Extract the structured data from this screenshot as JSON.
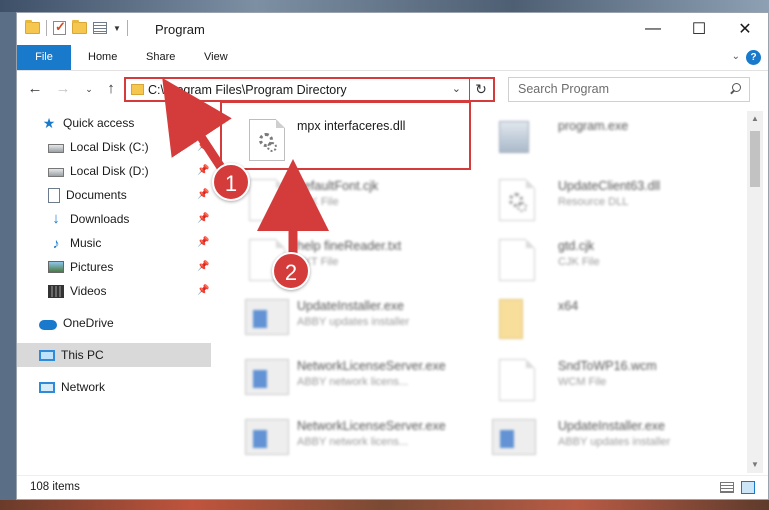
{
  "window": {
    "title": "Program",
    "controls": {
      "minimize": "—",
      "maximize": "☐",
      "close": "✕"
    }
  },
  "ribbon": {
    "tabs": [
      "File",
      "Home",
      "Share",
      "View"
    ],
    "help": "?"
  },
  "navigation": {
    "back": "←",
    "forward": "→",
    "recent": "⌄",
    "up": "↑",
    "address_path": "C:\\Program Files\\Program Directory",
    "refresh": "↻",
    "search_placeholder": "Search Program"
  },
  "sidebar": {
    "items": [
      {
        "label": "Quick access",
        "icon": "star-icon",
        "pinned": false
      },
      {
        "label": "Local Disk (C:)",
        "icon": "drive-icon",
        "pinned": true
      },
      {
        "label": "Local Disk (D:)",
        "icon": "drive-icon",
        "pinned": true
      },
      {
        "label": "Documents",
        "icon": "documents-icon",
        "pinned": true
      },
      {
        "label": "Downloads",
        "icon": "download-icon",
        "pinned": true
      },
      {
        "label": "Music",
        "icon": "music-icon",
        "pinned": true
      },
      {
        "label": "Pictures",
        "icon": "pictures-icon",
        "pinned": true
      },
      {
        "label": "Videos",
        "icon": "videos-icon",
        "pinned": true
      },
      {
        "label": "OneDrive",
        "icon": "cloud-icon",
        "pinned": false
      },
      {
        "label": "This PC",
        "icon": "computer-icon",
        "pinned": false,
        "selected": true
      },
      {
        "label": "Network",
        "icon": "network-icon",
        "pinned": false
      }
    ]
  },
  "files": [
    {
      "name": "mpx interfaceres.dll",
      "type": "",
      "icon": "dll-gear-icon",
      "highlighted": true
    },
    {
      "name": "program.exe",
      "type": "",
      "icon": "exe-icon"
    },
    {
      "name": "defaultFont.cjk",
      "type": "CJK File",
      "icon": "document-icon"
    },
    {
      "name": "UpdateClient63.dll",
      "type": "Resource DLL",
      "icon": "dll-gear-icon"
    },
    {
      "name": "help fineReader.txt",
      "type": "TXT File",
      "icon": "document-icon"
    },
    {
      "name": "gtd.cjk",
      "type": "CJK File",
      "icon": "document-icon"
    },
    {
      "name": "UpdateInstaller.exe",
      "type": "ABBY updates installer",
      "icon": "app-icon"
    },
    {
      "name": "x64",
      "type": "",
      "icon": "folder-icon"
    },
    {
      "name": "NetworkLicenseServer.exe",
      "type": "ABBY network licens...",
      "icon": "app-icon"
    },
    {
      "name": "SndToWP16.wcm",
      "type": "WCM File",
      "icon": "document-icon"
    },
    {
      "name": "NetworkLicenseServer.exe",
      "type": "ABBY network licens...",
      "icon": "app-icon"
    },
    {
      "name": "UpdateInstaller.exe",
      "type": "ABBY updates installer",
      "icon": "app-icon"
    }
  ],
  "annotations": {
    "step1": "1",
    "step2": "2",
    "accent_color": "#d43c3c"
  },
  "statusbar": {
    "item_count": "108 items"
  },
  "colors": {
    "file_tab": "#1979ca",
    "selection": "#d9d9d9"
  }
}
